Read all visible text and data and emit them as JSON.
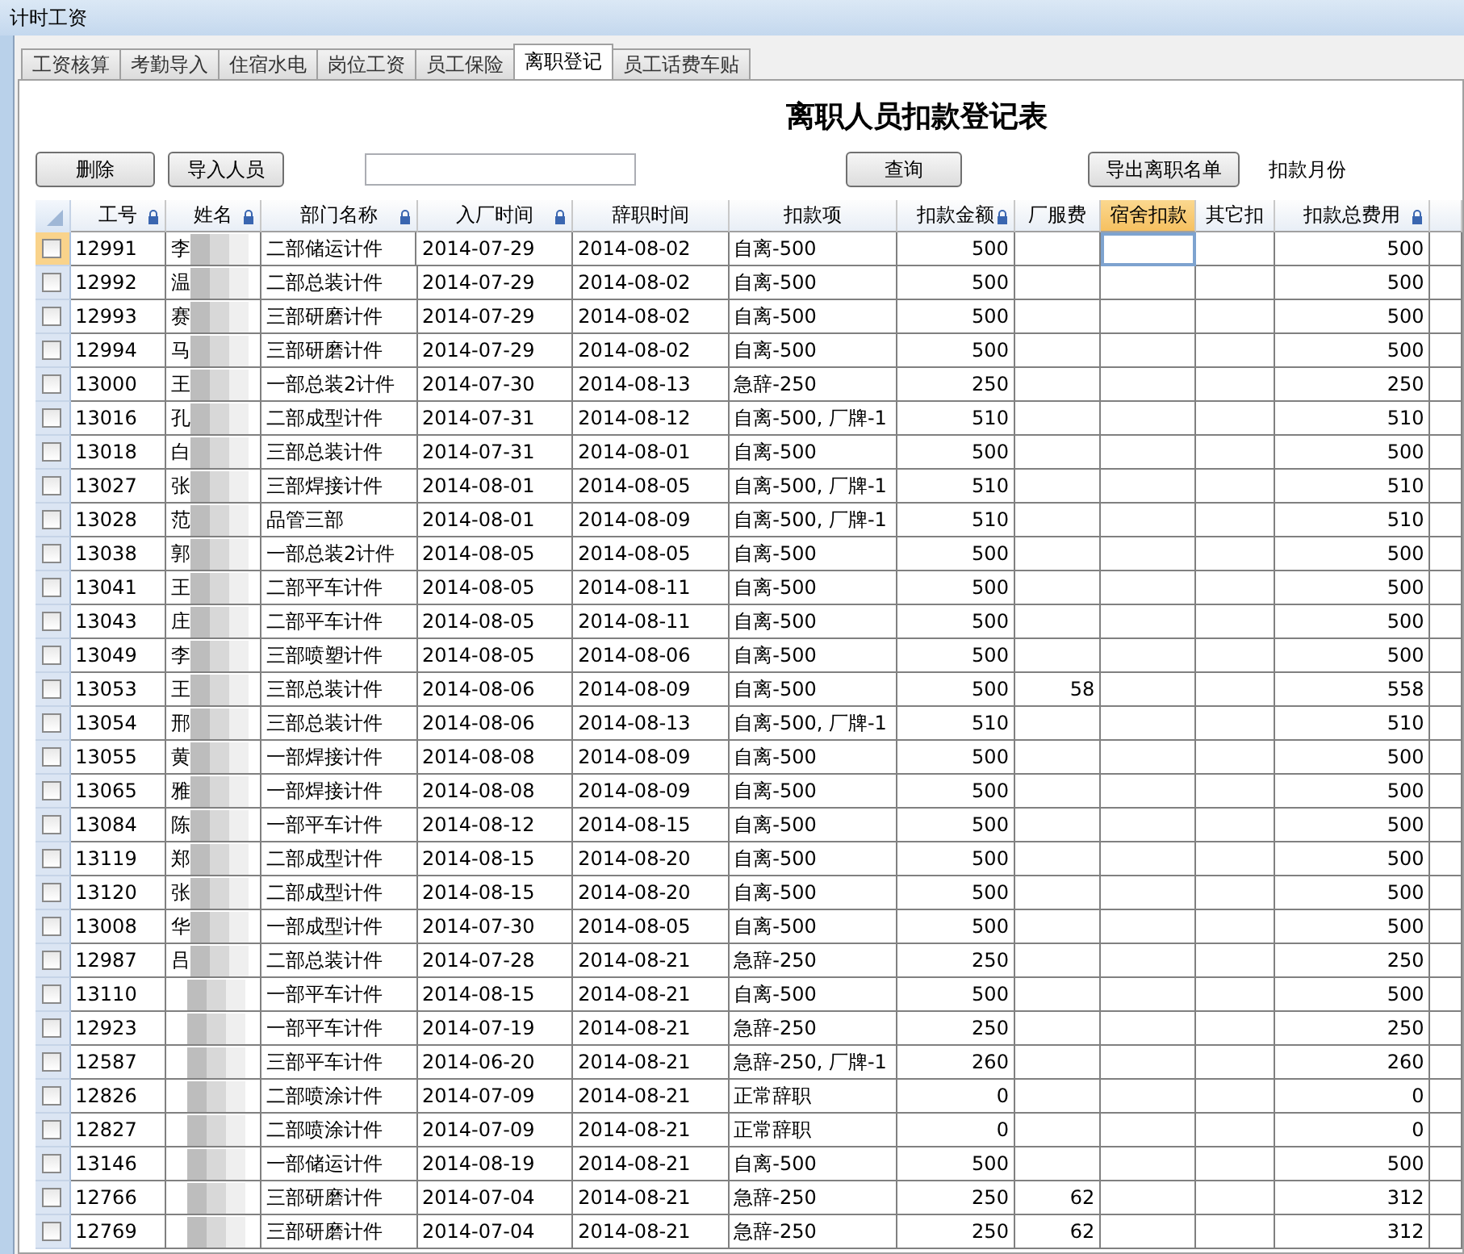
{
  "window": {
    "title": "计时工资"
  },
  "tabs": [
    {
      "label": "工资核算",
      "selected": false
    },
    {
      "label": "考勤导入",
      "selected": false
    },
    {
      "label": "住宿水电",
      "selected": false
    },
    {
      "label": "岗位工资",
      "selected": false
    },
    {
      "label": "员工保险",
      "selected": false
    },
    {
      "label": "离职登记",
      "selected": true
    },
    {
      "label": "员工话费车贴",
      "selected": false
    }
  ],
  "heading": "离职人员扣款登记表",
  "toolbar": {
    "delete_button": "删除",
    "import_button": "导入人员",
    "query_button": "查询",
    "export_button": "导出离职名单",
    "month_label": "扣款月份"
  },
  "table": {
    "columns": [
      {
        "label": "工号",
        "locked": true,
        "selected": false
      },
      {
        "label": "姓名",
        "locked": true,
        "selected": false
      },
      {
        "label": "部门名称",
        "locked": true,
        "selected": false
      },
      {
        "label": "入厂时间",
        "locked": true,
        "selected": false
      },
      {
        "label": "辞职时间",
        "locked": false,
        "selected": false
      },
      {
        "label": "扣款项",
        "locked": false,
        "selected": false
      },
      {
        "label": "扣款金额",
        "locked": true,
        "selected": false
      },
      {
        "label": "厂服费",
        "locked": false,
        "selected": false
      },
      {
        "label": "宿舍扣款",
        "locked": false,
        "selected": true
      },
      {
        "label": "其它扣",
        "locked": false,
        "selected": false
      },
      {
        "label": "扣款总费用",
        "locked": true,
        "selected": false
      }
    ],
    "rows": [
      {
        "checked": false,
        "current": true,
        "cells": [
          "12991",
          "李",
          "二部储运计件",
          "2014-07-29",
          "2014-08-02",
          "自离-500",
          "500",
          "",
          "",
          "",
          "500"
        ]
      },
      {
        "checked": false,
        "current": false,
        "cells": [
          "12992",
          "温",
          "二部总装计件",
          "2014-07-29",
          "2014-08-02",
          "自离-500",
          "500",
          "",
          "",
          "",
          "500"
        ]
      },
      {
        "checked": false,
        "current": false,
        "cells": [
          "12993",
          "赛",
          "三部研磨计件",
          "2014-07-29",
          "2014-08-02",
          "自离-500",
          "500",
          "",
          "",
          "",
          "500"
        ]
      },
      {
        "checked": false,
        "current": false,
        "cells": [
          "12994",
          "马",
          "三部研磨计件",
          "2014-07-29",
          "2014-08-02",
          "自离-500",
          "500",
          "",
          "",
          "",
          "500"
        ]
      },
      {
        "checked": false,
        "current": false,
        "cells": [
          "13000",
          "王",
          "一部总装2计件",
          "2014-07-30",
          "2014-08-13",
          "急辞-250",
          "250",
          "",
          "",
          "",
          "250"
        ]
      },
      {
        "checked": false,
        "current": false,
        "cells": [
          "13016",
          "孔",
          "二部成型计件",
          "2014-07-31",
          "2014-08-12",
          "自离-500, 厂牌-1",
          "510",
          "",
          "",
          "",
          "510"
        ]
      },
      {
        "checked": false,
        "current": false,
        "cells": [
          "13018",
          "白",
          "三部总装计件",
          "2014-07-31",
          "2014-08-01",
          "自离-500",
          "500",
          "",
          "",
          "",
          "500"
        ]
      },
      {
        "checked": false,
        "current": false,
        "cells": [
          "13027",
          "张",
          "三部焊接计件",
          "2014-08-01",
          "2014-08-05",
          "自离-500, 厂牌-1",
          "510",
          "",
          "",
          "",
          "510"
        ]
      },
      {
        "checked": false,
        "current": false,
        "cells": [
          "13028",
          "范",
          "品管三部",
          "2014-08-01",
          "2014-08-09",
          "自离-500, 厂牌-1",
          "510",
          "",
          "",
          "",
          "510"
        ]
      },
      {
        "checked": false,
        "current": false,
        "cells": [
          "13038",
          "郭",
          "一部总装2计件",
          "2014-08-05",
          "2014-08-05",
          "自离-500",
          "500",
          "",
          "",
          "",
          "500"
        ]
      },
      {
        "checked": false,
        "current": false,
        "cells": [
          "13041",
          "王",
          "二部平车计件",
          "2014-08-05",
          "2014-08-11",
          "自离-500",
          "500",
          "",
          "",
          "",
          "500"
        ]
      },
      {
        "checked": false,
        "current": false,
        "cells": [
          "13043",
          "庄",
          "二部平车计件",
          "2014-08-05",
          "2014-08-11",
          "自离-500",
          "500",
          "",
          "",
          "",
          "500"
        ]
      },
      {
        "checked": false,
        "current": false,
        "cells": [
          "13049",
          "李",
          "三部喷塑计件",
          "2014-08-05",
          "2014-08-06",
          "自离-500",
          "500",
          "",
          "",
          "",
          "500"
        ]
      },
      {
        "checked": false,
        "current": false,
        "cells": [
          "13053",
          "王",
          "三部总装计件",
          "2014-08-06",
          "2014-08-09",
          "自离-500",
          "500",
          "58",
          "",
          "",
          "558"
        ]
      },
      {
        "checked": false,
        "current": false,
        "cells": [
          "13054",
          "邢",
          "三部总装计件",
          "2014-08-06",
          "2014-08-13",
          "自离-500, 厂牌-1",
          "510",
          "",
          "",
          "",
          "510"
        ]
      },
      {
        "checked": false,
        "current": false,
        "cells": [
          "13055",
          "黄",
          "一部焊接计件",
          "2014-08-08",
          "2014-08-09",
          "自离-500",
          "500",
          "",
          "",
          "",
          "500"
        ]
      },
      {
        "checked": false,
        "current": false,
        "cells": [
          "13065",
          "雅",
          "一部焊接计件",
          "2014-08-08",
          "2014-08-09",
          "自离-500",
          "500",
          "",
          "",
          "",
          "500"
        ]
      },
      {
        "checked": false,
        "current": false,
        "cells": [
          "13084",
          "陈",
          "一部平车计件",
          "2014-08-12",
          "2014-08-15",
          "自离-500",
          "500",
          "",
          "",
          "",
          "500"
        ]
      },
      {
        "checked": false,
        "current": false,
        "cells": [
          "13119",
          "郑",
          "二部成型计件",
          "2014-08-15",
          "2014-08-20",
          "自离-500",
          "500",
          "",
          "",
          "",
          "500"
        ]
      },
      {
        "checked": false,
        "current": false,
        "cells": [
          "13120",
          "张",
          "二部成型计件",
          "2014-08-15",
          "2014-08-20",
          "自离-500",
          "500",
          "",
          "",
          "",
          "500"
        ]
      },
      {
        "checked": false,
        "current": false,
        "cells": [
          "13008",
          "华",
          "一部成型计件",
          "2014-07-30",
          "2014-08-05",
          "自离-500",
          "500",
          "",
          "",
          "",
          "500"
        ]
      },
      {
        "checked": false,
        "current": false,
        "cells": [
          "12987",
          "吕",
          "二部总装计件",
          "2014-07-28",
          "2014-08-21",
          "急辞-250",
          "250",
          "",
          "",
          "",
          "250"
        ]
      },
      {
        "checked": false,
        "current": false,
        "cells": [
          "13110",
          "",
          "一部平车计件",
          "2014-08-15",
          "2014-08-21",
          "自离-500",
          "500",
          "",
          "",
          "",
          "500"
        ]
      },
      {
        "checked": false,
        "current": false,
        "cells": [
          "12923",
          "",
          "一部平车计件",
          "2014-07-19",
          "2014-08-21",
          "急辞-250",
          "250",
          "",
          "",
          "",
          "250"
        ]
      },
      {
        "checked": false,
        "current": false,
        "cells": [
          "12587",
          "",
          "三部平车计件",
          "2014-06-20",
          "2014-08-21",
          "急辞-250, 厂牌-1",
          "260",
          "",
          "",
          "",
          "260"
        ]
      },
      {
        "checked": false,
        "current": false,
        "cells": [
          "12826",
          "",
          "二部喷涂计件",
          "2014-07-09",
          "2014-08-21",
          "正常辞职",
          "0",
          "",
          "",
          "",
          "0"
        ]
      },
      {
        "checked": false,
        "current": false,
        "cells": [
          "12827",
          "",
          "二部喷涂计件",
          "2014-07-09",
          "2014-08-21",
          "正常辞职",
          "0",
          "",
          "",
          "",
          "0"
        ]
      },
      {
        "checked": false,
        "current": false,
        "cells": [
          "13146",
          "",
          "一部储运计件",
          "2014-08-19",
          "2014-08-21",
          "自离-500",
          "500",
          "",
          "",
          "",
          "500"
        ]
      },
      {
        "checked": false,
        "current": false,
        "cells": [
          "12766",
          "",
          "三部研磨计件",
          "2014-07-04",
          "2014-08-21",
          "急辞-250",
          "250",
          "62",
          "",
          "",
          "312"
        ]
      },
      {
        "checked": false,
        "current": false,
        "cells": [
          "12769",
          "",
          "三部研磨计件",
          "2014-07-04",
          "2014-08-21",
          "急辞-250",
          "250",
          "62",
          "",
          "",
          "312"
        ]
      }
    ]
  }
}
